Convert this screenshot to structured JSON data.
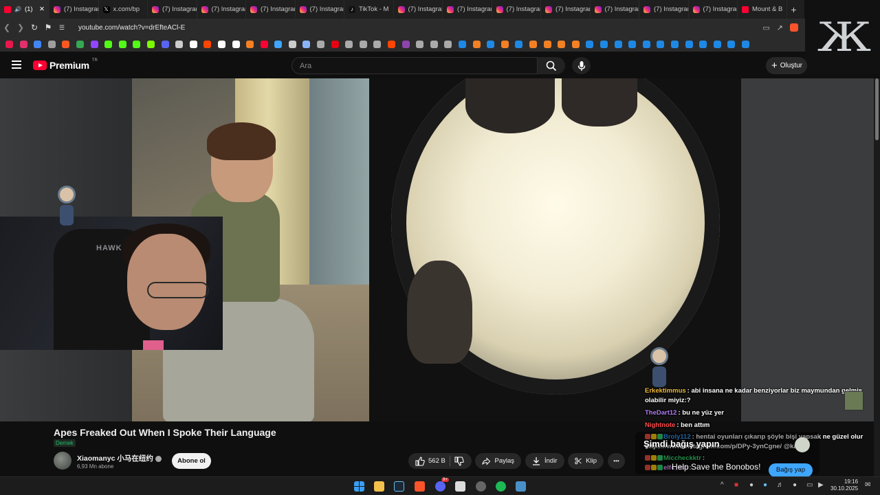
{
  "browser": {
    "tabs": [
      {
        "title": "(1)",
        "favicon": "youtube-icon",
        "active": true
      },
      {
        "title": "(7) Instagram",
        "favicon": "instagram-icon"
      },
      {
        "title": "x.com/bp",
        "favicon": "x-icon"
      },
      {
        "title": "(7) Instagram",
        "favicon": "instagram-icon"
      },
      {
        "title": "(7) Instagram",
        "favicon": "instagram-icon"
      },
      {
        "title": "(7) Instagram",
        "favicon": "instagram-icon"
      },
      {
        "title": "(7) Instagram",
        "favicon": "instagram-icon"
      },
      {
        "title": "TikTok - M",
        "favicon": "tiktok-icon"
      },
      {
        "title": "(7) Instagram",
        "favicon": "instagram-icon"
      },
      {
        "title": "(7) Instagram",
        "favicon": "instagram-icon"
      },
      {
        "title": "(7) Instagram",
        "favicon": "instagram-icon"
      },
      {
        "title": "(7) Instagram",
        "favicon": "instagram-icon"
      },
      {
        "title": "(7) Instagram",
        "favicon": "instagram-icon"
      },
      {
        "title": "(7) Instagram",
        "favicon": "instagram-icon"
      },
      {
        "title": "(7) Instagram",
        "favicon": "instagram-icon"
      },
      {
        "title": "Mount & B",
        "favicon": "youtube-icon"
      }
    ],
    "url": "youtube.com/watch?v=drEfteACl-E",
    "bookmark_colors": [
      "#e8184d",
      "#e1306c",
      "#4285f4",
      "#9e9e9e",
      "#ff5722",
      "#34a853",
      "#9146ff",
      "#53fc18",
      "#53fc18",
      "#53fc18",
      "#7cfc00",
      "#5865f2",
      "#cccccc",
      "#ffffff",
      "#ff4500",
      "#ffffff",
      "#ffffff",
      "#f48024",
      "#ff0033",
      "#3ea6ff",
      "#cccccc",
      "#8ab4f8",
      "#aaaaaa",
      "#e60012",
      "#aaaaaa",
      "#aaaaaa",
      "#aaaaaa",
      "#ff4500",
      "#8e44ad",
      "#aaaaaa",
      "#aaaaaa",
      "#aaaaaa",
      "#1e88e5",
      "#f48024",
      "#1e88e5",
      "#f48024",
      "#1e88e5",
      "#f48024",
      "#f48024",
      "#f48024",
      "#f48024",
      "#1e88e5",
      "#1e88e5",
      "#1e88e5",
      "#1e88e5",
      "#1e88e5",
      "#1e88e5",
      "#1e88e5",
      "#1e88e5",
      "#1e88e5",
      "#1e88e5",
      "#1e88e5",
      "#1e88e5"
    ]
  },
  "youtube": {
    "logo_text": "Premium",
    "region": "TR",
    "search_placeholder": "Ara",
    "create_label": "Oluştur"
  },
  "chat": {
    "messages": [
      {
        "user": "Erkektimmus",
        "user_color": "#f0b93a",
        "text": ": abi insana ne kadar benziyorlar biz maymundan gelmiş"
      },
      {
        "user": "",
        "user_color": "#ffffff",
        "text": "olabilir miyiz:?"
      },
      {
        "user": "TheDart12",
        "user_color": "#b07cf0",
        "text": ": bu ne yüz yer"
      },
      {
        "user": "Nightnote",
        "user_color": "#ff4d4d",
        "text": ": ben attım"
      },
      {
        "user": "Broly112",
        "user_color": "#2f9bff",
        "text": ": hentai oyunları çıkarıp şöyle bişi yapsak ne güzel olur"
      },
      {
        "user": "",
        "user_color": "#ffffff",
        "text": "https://www.instagram.com/p/DPy-3ynCgne/ @kaan"
      },
      {
        "user": "Miccheckktr",
        "user_color": "#3ad870",
        "text": ":"
      },
      {
        "user": "elfc_atc",
        "user_color": "#e6a0ff",
        "text": ":"
      }
    ],
    "donation": {
      "title": "Şimdi bağış yapın",
      "subtitle": "Help Save the Bonobos!",
      "button": "Bağış yap"
    }
  },
  "video": {
    "title": "Apes Freaked Out When I Spoke Their Language",
    "category": "Dernek",
    "webcam_brand": "HAWK"
  },
  "channel": {
    "name": "Xiaomanyc 小马在纽约",
    "subscribers": "6,93 Mn abone",
    "subscribe_label": "Abone ol"
  },
  "actions": {
    "likes": "562 B",
    "share": "Paylaş",
    "download": "İndir",
    "clip": "Klip",
    "more": "•••"
  },
  "taskbar": {
    "time": "19:16",
    "date": "30.10.2025",
    "discord_badge": "9+"
  }
}
